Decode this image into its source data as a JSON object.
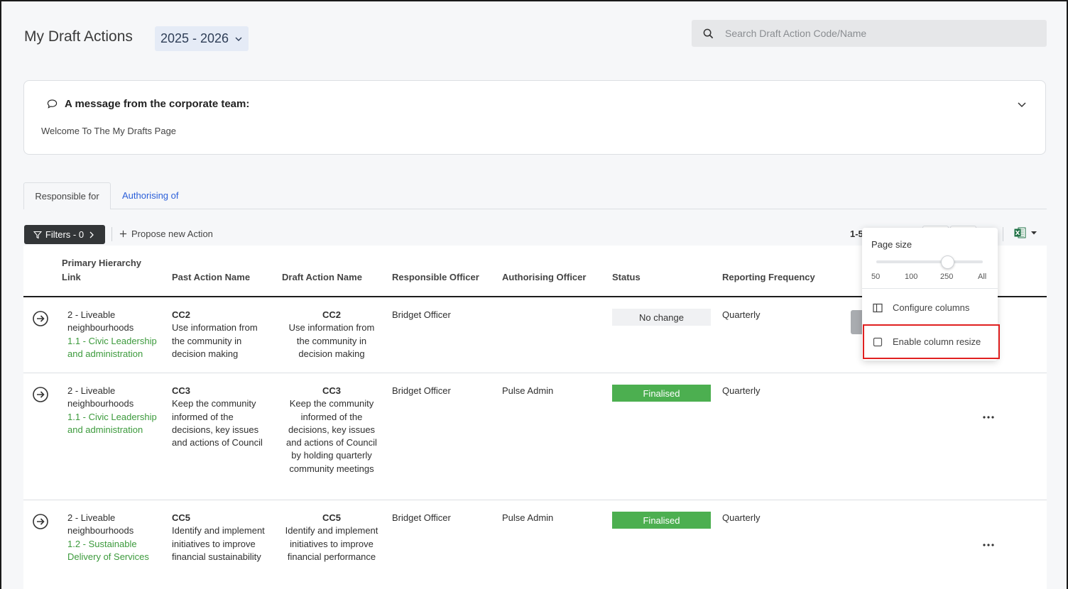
{
  "header": {
    "title": "My Draft Actions",
    "year": "2025 - 2026",
    "search_placeholder": "Search Draft Action Code/Name"
  },
  "message": {
    "heading": "A message from the corporate team:",
    "text": "Welcome To The My Drafts Page"
  },
  "tabs": [
    {
      "label": "Responsible for",
      "active": true
    },
    {
      "label": "Authorising of",
      "active": false
    }
  ],
  "toolbar": {
    "filters_label": "Filters - 0",
    "propose_label": "Propose new Action",
    "range_text": "1-5"
  },
  "columns": [
    "Primary Hierarchy Link",
    "Past Action Name",
    "Draft Action Name",
    "Responsible Officer",
    "Authorising Officer",
    "Status",
    "Reporting Frequency"
  ],
  "rows": [
    {
      "hierarchy_l1": "2 - Liveable neighbourhoods",
      "hierarchy_l2": "1.1 - Civic Leadership and administration",
      "past_code": "CC2",
      "past_name": "Use information from the community in decision making",
      "draft_code": "CC2",
      "draft_name": "Use information from the community in decision making",
      "responsible": "Bridget Officer",
      "authorising": "",
      "status": "No change",
      "frequency": "Quarterly"
    },
    {
      "hierarchy_l1": "2 - Liveable neighbourhoods",
      "hierarchy_l2": "1.1 - Civic Leadership and administration",
      "past_code": "CC3",
      "past_name": "Keep the community informed of the decisions, key issues and actions of Council",
      "draft_code": "CC3",
      "draft_name": "Keep the community informed of the decisions, key issues and actions of Council by holding quarterly community meetings",
      "responsible": "Bridget Officer",
      "authorising": "Pulse Admin",
      "status": "Finalised",
      "frequency": "Quarterly"
    },
    {
      "hierarchy_l1": "2 - Liveable neighbourhoods",
      "hierarchy_l2": "1.2 - Sustainable Delivery of Services",
      "past_code": "CC5",
      "past_name": "Identify and implement initiatives to improve financial sustainability",
      "draft_code": "CC5",
      "draft_name": "Identify and implement initiatives to improve financial performance",
      "responsible": "Bridget Officer",
      "authorising": "Pulse Admin",
      "status": "Finalised",
      "frequency": "Quarterly"
    }
  ],
  "popup": {
    "page_size_label": "Page size",
    "ticks": [
      "50",
      "100",
      "250",
      "All"
    ],
    "selected_page_size": "250",
    "configure_label": "Configure columns",
    "resize_label": "Enable column resize",
    "resize_checked": false
  },
  "colors": {
    "accent_link": "#2b5fd9",
    "status_finalised": "#4caf50",
    "hierarchy_green": "#3c9a3c",
    "highlight_red": "#e02020"
  }
}
